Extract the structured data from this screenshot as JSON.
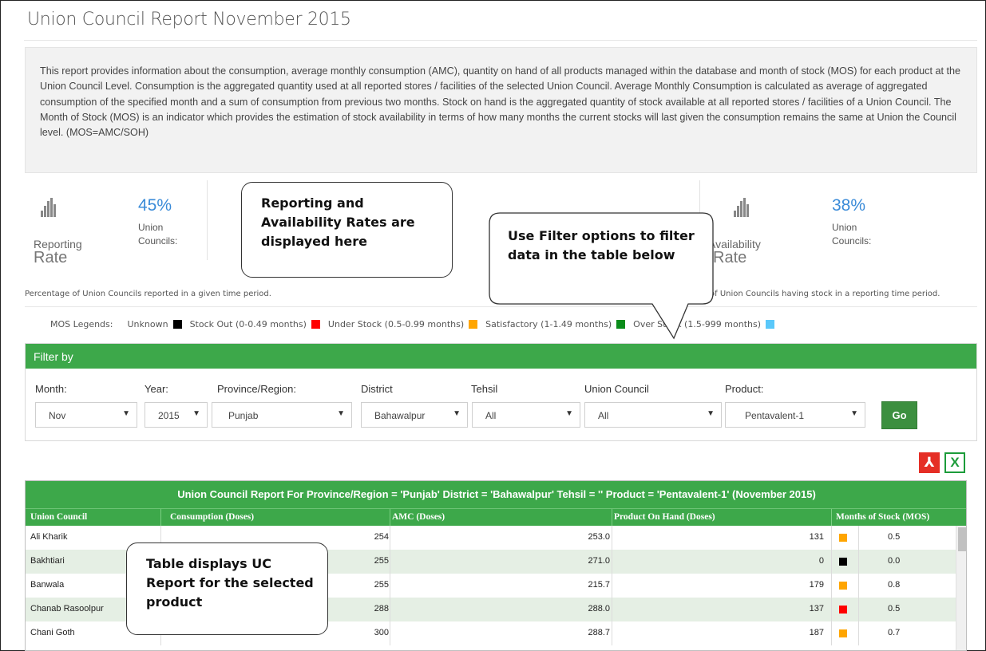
{
  "page": {
    "title": "Union Council Report November 2015",
    "description": "This report provides information about the consumption, average monthly consumption (AMC), quantity on hand of all products managed within the database and month of stock (MOS) for each product at the Union Council Level. Consumption is the aggregated quantity used at all reported stores / facilities of the selected Union Council. Average Monthly Consumption is calculated as average of aggregated consumption of the specified month and a sum of consumption from previous two months. Stock on hand is the aggregated quantity of stock available at all reported stores / facilities of a Union Council. The Month of Stock (MOS) is an indicator which provides the estimation of stock availability in terms of how many months the current stocks will last given the consumption remains the same at Union the Council level. (MOS=AMC/SOH)"
  },
  "reporting": {
    "pct": "45%",
    "sub": "Union Councils:",
    "name": "Reporting",
    "word": "Rate",
    "note": "Percentage of Union Councils reported in a given time period."
  },
  "availability": {
    "pct": "38%",
    "sub": "Union Councils:",
    "name": "Availability",
    "word": "Rate",
    "note": "of Union Councils having stock in a reporting time period."
  },
  "legend": {
    "label": "MOS Legends:",
    "items": [
      {
        "label": "Unknown",
        "color": "#000000"
      },
      {
        "label": "Stock Out (0-0.49 months)",
        "color": "#ff0000"
      },
      {
        "label": "Under Stock (0.5-0.99 months)",
        "color": "#ffa500"
      },
      {
        "label": "Satisfactory (1-1.49 months)",
        "color": "#0a8c1a"
      },
      {
        "label": "Over Stock (1.5-999 months)",
        "color": "#5ac8fa"
      }
    ]
  },
  "filter": {
    "heading": "Filter by",
    "month_label": "Month:",
    "month_value": "Nov",
    "year_label": "Year:",
    "year_value": "2015",
    "province_label": "Province/Region:",
    "province_value": "Punjab",
    "district_label": "District",
    "district_value": "Bahawalpur",
    "tehsil_label": "Tehsil",
    "tehsil_value": "All",
    "uc_label": "Union Council",
    "uc_value": "All",
    "product_label": "Product:",
    "product_value": "Pentavalent-1",
    "go_label": "Go"
  },
  "export": {
    "pdf_glyph": "⅄",
    "xls_glyph": "X"
  },
  "table": {
    "title": "Union Council Report For Province/Region = 'Punjab' District = 'Bahawalpur' Tehsil = '' Product = 'Pentavalent-1' (November 2015)",
    "columns": [
      "Union Council",
      "Consumption (Doses)",
      "AMC (Doses)",
      "Product On Hand (Doses)",
      "Months of Stock (MOS)"
    ],
    "rows": [
      {
        "uc": "Ali Kharik",
        "consumption": "254",
        "amc": "253.0",
        "soh": "131",
        "mos_color": "#ffa500",
        "mos": "0.5"
      },
      {
        "uc": "Bakhtiari",
        "consumption": "255",
        "amc": "271.0",
        "soh": "0",
        "mos_color": "#000000",
        "mos": "0.0"
      },
      {
        "uc": "Banwala",
        "consumption": "255",
        "amc": "215.7",
        "soh": "179",
        "mos_color": "#ffa500",
        "mos": "0.8"
      },
      {
        "uc": "Chanab Rasoolpur",
        "consumption": "288",
        "amc": "288.0",
        "soh": "137",
        "mos_color": "#ff0000",
        "mos": "0.5"
      },
      {
        "uc": "Chani Goth",
        "consumption": "300",
        "amc": "288.7",
        "soh": "187",
        "mos_color": "#ffa500",
        "mos": "0.7"
      }
    ]
  },
  "callouts": {
    "rates": "Reporting and Availability Rates are displayed here",
    "filter": "Use Filter options to filter data in the table below",
    "table": "Table displays UC Report for the selected product"
  }
}
